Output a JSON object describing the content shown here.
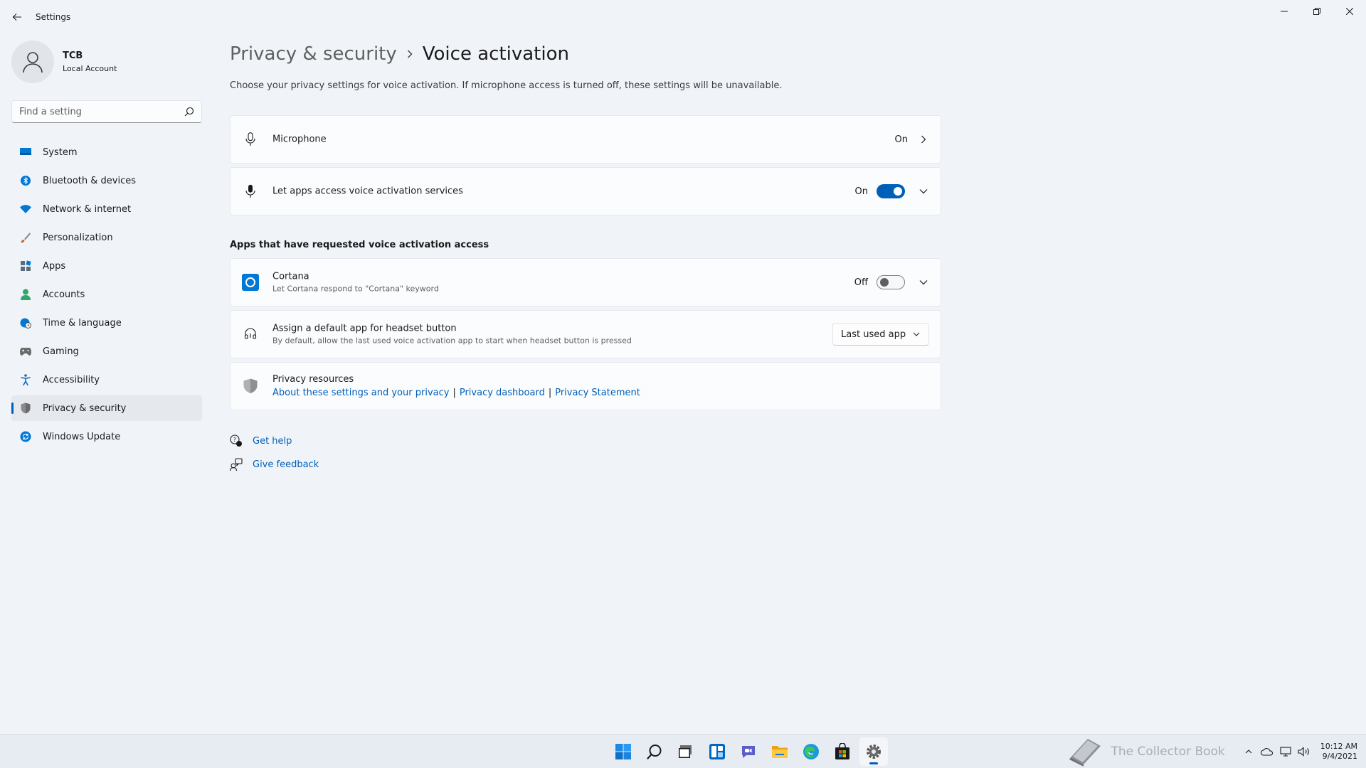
{
  "window": {
    "title": "Settings"
  },
  "profile": {
    "name": "TCB",
    "account_type": "Local Account"
  },
  "search": {
    "placeholder": "Find a setting"
  },
  "sidebar": {
    "items": [
      {
        "label": "System",
        "icon": "system-icon",
        "color": "#0078d4"
      },
      {
        "label": "Bluetooth & devices",
        "icon": "bluetooth-icon",
        "color": "#0078d4"
      },
      {
        "label": "Network & internet",
        "icon": "wifi-icon",
        "color": "#0078d4"
      },
      {
        "label": "Personalization",
        "icon": "brush-icon",
        "color": "#c36a32"
      },
      {
        "label": "Apps",
        "icon": "apps-icon",
        "color": "#5b6b7b"
      },
      {
        "label": "Accounts",
        "icon": "person-icon",
        "color": "#2fa86a"
      },
      {
        "label": "Time & language",
        "icon": "globe-clock-icon",
        "color": "#0078d4"
      },
      {
        "label": "Gaming",
        "icon": "gamepad-icon",
        "color": "#6b6b6b"
      },
      {
        "label": "Accessibility",
        "icon": "accessibility-icon",
        "color": "#0f6cbd"
      },
      {
        "label": "Privacy & security",
        "icon": "shield-icon",
        "color": "#7a7a7a",
        "active": true
      },
      {
        "label": "Windows Update",
        "icon": "update-icon",
        "color": "#0078d4"
      }
    ]
  },
  "main": {
    "breadcrumb_parent": "Privacy & security",
    "breadcrumb_current": "Voice activation",
    "description": "Choose your privacy settings for voice activation. If microphone access is turned off, these settings will be unavailable.",
    "microphone": {
      "title": "Microphone",
      "state": "On"
    },
    "voice_access": {
      "title": "Let apps access voice activation services",
      "state": "On",
      "enabled": true
    },
    "apps_section_header": "Apps that have requested voice activation access",
    "cortana": {
      "title": "Cortana",
      "subtitle": "Let Cortana respond to \"Cortana\" keyword",
      "state": "Off",
      "enabled": false
    },
    "headset": {
      "title": "Assign a default app for headset button",
      "subtitle": "By default, allow the last used voice activation app to start when headset button is pressed",
      "selected": "Last used app"
    },
    "privacy_resources": {
      "title": "Privacy resources",
      "links": [
        "About these settings and your privacy",
        "Privacy dashboard",
        "Privacy Statement"
      ]
    },
    "help": {
      "get_help": "Get help",
      "give_feedback": "Give feedback"
    }
  },
  "taskbar": {
    "apps": [
      "start-icon",
      "search-icon",
      "task-view-icon",
      "widgets-icon",
      "chat-icon",
      "file-explorer-icon",
      "edge-icon",
      "store-icon",
      "settings-icon"
    ],
    "active_app": "settings-icon",
    "watermark_text": "The Collector Book",
    "clock_time": "10:12 AM",
    "clock_date": "9/4/2021"
  },
  "colors": {
    "accent": "#005fb8",
    "background": "#f0f4f9",
    "card": "#fbfcfd"
  }
}
